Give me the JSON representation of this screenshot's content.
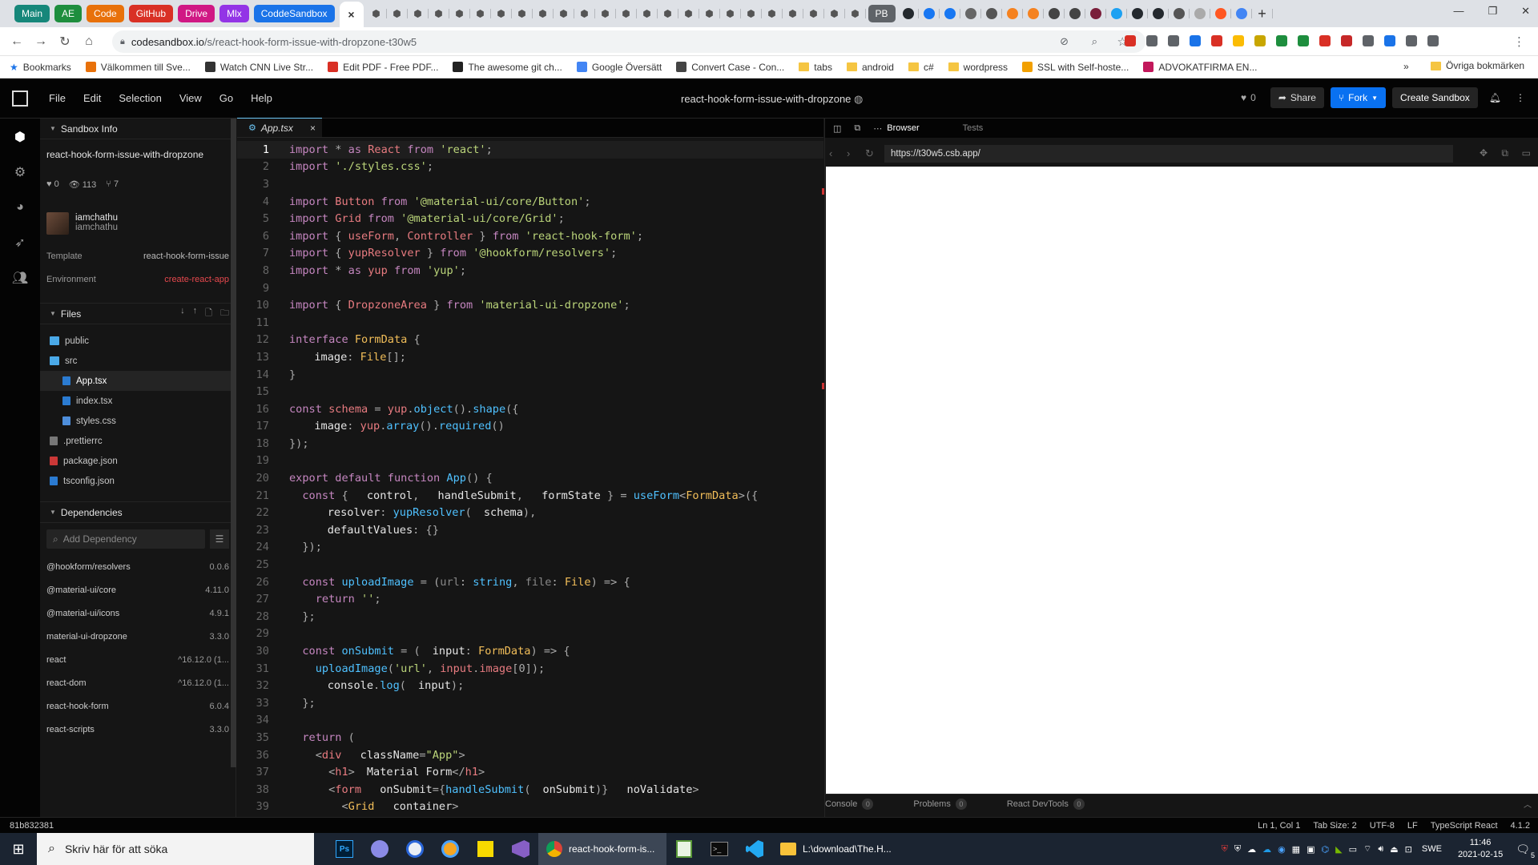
{
  "browser": {
    "group_tabs": [
      {
        "label": "Main",
        "color": "#16877a"
      },
      {
        "label": "AE",
        "color": "#1e8e3e"
      },
      {
        "label": "Code",
        "color": "#e8710a"
      },
      {
        "label": "GitHub",
        "color": "#d93025"
      },
      {
        "label": "Drive",
        "color": "#d01884"
      },
      {
        "label": "Mlx",
        "color": "#9334e6"
      },
      {
        "label": "CoddeSandbox",
        "color": "#1a73e8"
      }
    ],
    "group_tab_last": {
      "label": "PB",
      "color": "#5f6368"
    },
    "active_tab_close": "×",
    "new_tab": "+",
    "url_host": "codesandbox.io",
    "url_path": "/s/react-hook-form-issue-with-dropzone-t30w5",
    "bookmarks": [
      {
        "label": "Bookmarks",
        "kind": "star",
        "color": "#1a73e8"
      },
      {
        "label": "Välkommen till Sve...",
        "kind": "icon",
        "color": "#e8710a"
      },
      {
        "label": "Watch CNN Live Str...",
        "kind": "icon",
        "color": "#333333"
      },
      {
        "label": "Edit PDF - Free PDF...",
        "kind": "icon",
        "color": "#d93025"
      },
      {
        "label": "The awesome git ch...",
        "kind": "icon",
        "color": "#222222"
      },
      {
        "label": "Google Översätt",
        "kind": "icon",
        "color": "#4285f4"
      },
      {
        "label": "Convert Case - Con...",
        "kind": "icon",
        "color": "#444444"
      },
      {
        "label": "tabs",
        "kind": "folder"
      },
      {
        "label": "android",
        "kind": "folder"
      },
      {
        "label": "c#",
        "kind": "folder"
      },
      {
        "label": "wordpress",
        "kind": "folder"
      },
      {
        "label": "SSL with Self-hoste...",
        "kind": "icon",
        "color": "#f2a000"
      },
      {
        "label": "ADVOKATFIRMA EN...",
        "kind": "icon",
        "color": "#c2185b"
      }
    ],
    "bookmarks_more": "»",
    "other_bookmarks": "Övriga bokmärken"
  },
  "cs": {
    "menu": [
      "File",
      "Edit",
      "Selection",
      "View",
      "Go",
      "Help"
    ],
    "title": "react-hook-form-issue-with-dropzone",
    "likes": "0",
    "share": "Share",
    "fork": "Fork",
    "create": "Create Sandbox"
  },
  "sidebar": {
    "info_header": "Sandbox Info",
    "sandbox_name": "react-hook-form-issue-with-dropzone",
    "stats": {
      "likes": "0",
      "views": "113",
      "forks": "7"
    },
    "author_name": "iamchathu",
    "author_user": "iamchathu",
    "template_label": "Template",
    "template_value": "react-hook-form-issue",
    "env_label": "Environment",
    "env_value": "create-react-app",
    "files_header": "Files",
    "files": [
      {
        "name": "public",
        "indent": 0,
        "kind": "folder",
        "color": "#4aa9e8",
        "selected": false
      },
      {
        "name": "src",
        "indent": 0,
        "kind": "folder-open",
        "color": "#4aa9e8",
        "selected": false
      },
      {
        "name": "App.tsx",
        "indent": 1,
        "kind": "file",
        "color": "#2b7bd1",
        "selected": true
      },
      {
        "name": "index.tsx",
        "indent": 1,
        "kind": "file",
        "color": "#2b7bd1",
        "selected": false
      },
      {
        "name": "styles.css",
        "indent": 1,
        "kind": "file",
        "color": "#4e8edb",
        "selected": false
      },
      {
        "name": ".prettierrc",
        "indent": 0,
        "kind": "file",
        "color": "#777777",
        "selected": false
      },
      {
        "name": "package.json",
        "indent": 0,
        "kind": "file",
        "color": "#cb3837",
        "selected": false
      },
      {
        "name": "tsconfig.json",
        "indent": 0,
        "kind": "file",
        "color": "#2b7bd1",
        "selected": false
      }
    ],
    "deps_header": "Dependencies",
    "add_dep_placeholder": "Add Dependency",
    "deps": [
      {
        "name": "@hookform/resolvers",
        "version": "0.0.6"
      },
      {
        "name": "@material-ui/core",
        "version": "4.11.0"
      },
      {
        "name": "@material-ui/icons",
        "version": "4.9.1"
      },
      {
        "name": "material-ui-dropzone",
        "version": "3.3.0"
      },
      {
        "name": "react",
        "version": "^16.12.0 (1..."
      },
      {
        "name": "react-dom",
        "version": "^16.12.0 (1..."
      },
      {
        "name": "react-hook-form",
        "version": "6.0.4"
      },
      {
        "name": "react-scripts",
        "version": "3.3.0"
      }
    ]
  },
  "editor": {
    "tab_name": "App.tsx",
    "tab_close": "×",
    "current_line": 1,
    "lines": [
      [
        [
          "kw",
          "import"
        ],
        [
          "op",
          " * "
        ],
        [
          "kw",
          "as"
        ],
        [
          "id",
          " React "
        ],
        [
          "kw",
          "from"
        ],
        [
          "st",
          " 'react'"
        ],
        [
          "op",
          ";"
        ]
      ],
      [
        [
          "kw",
          "import"
        ],
        [
          "st",
          " './styles.css'"
        ],
        [
          "op",
          ";"
        ]
      ],
      [],
      [
        [
          "kw",
          "import"
        ],
        [
          "id",
          " Button "
        ],
        [
          "kw",
          "from"
        ],
        [
          "st",
          " '@material-ui/core/Button'"
        ],
        [
          "op",
          ";"
        ]
      ],
      [
        [
          "kw",
          "import"
        ],
        [
          "id",
          " Grid "
        ],
        [
          "kw",
          "from"
        ],
        [
          "st",
          " '@material-ui/core/Grid'"
        ],
        [
          "op",
          ";"
        ]
      ],
      [
        [
          "kw",
          "import"
        ],
        [
          "op",
          " { "
        ],
        [
          "id",
          "useForm"
        ],
        [
          "op",
          ", "
        ],
        [
          "id",
          "Controller"
        ],
        [
          "op",
          " } "
        ],
        [
          "kw",
          "from"
        ],
        [
          "st",
          " 'react-hook-form'"
        ],
        [
          "op",
          ";"
        ]
      ],
      [
        [
          "kw",
          "import"
        ],
        [
          "op",
          " { "
        ],
        [
          "id",
          "yupResolver"
        ],
        [
          "op",
          " } "
        ],
        [
          "kw",
          "from"
        ],
        [
          "st",
          " '@hookform/resolvers'"
        ],
        [
          "op",
          ";"
        ]
      ],
      [
        [
          "kw",
          "import"
        ],
        [
          "op",
          " * "
        ],
        [
          "kw",
          "as"
        ],
        [
          "id",
          " yup "
        ],
        [
          "kw",
          "from"
        ],
        [
          "st",
          " 'yup'"
        ],
        [
          "op",
          ";"
        ]
      ],
      [],
      [
        [
          "kw",
          "import"
        ],
        [
          "op",
          " { "
        ],
        [
          "id",
          "DropzoneArea"
        ],
        [
          "op",
          " } "
        ],
        [
          "kw",
          "from"
        ],
        [
          "st",
          " 'material-ui-dropzone'"
        ],
        [
          "op",
          ";"
        ]
      ],
      [],
      [
        [
          "kw",
          "interface"
        ],
        [
          "ty",
          " FormData"
        ],
        [
          "op",
          " {"
        ]
      ],
      [
        [
          "cl",
          "  image"
        ],
        [
          "op",
          ": "
        ],
        [
          "ty",
          "File"
        ],
        [
          "op",
          "[];"
        ]
      ],
      [
        [
          "op",
          "}"
        ]
      ],
      [],
      [
        [
          "kw",
          "const"
        ],
        [
          "id",
          " schema"
        ],
        [
          "op",
          " = "
        ],
        [
          "id",
          "yup"
        ],
        [
          "op",
          "."
        ],
        [
          "fn",
          "object"
        ],
        [
          "op",
          "()."
        ],
        [
          "fn",
          "shape"
        ],
        [
          "op",
          "({"
        ]
      ],
      [
        [
          "cl",
          "  image"
        ],
        [
          "op",
          ": "
        ],
        [
          "id",
          "yup"
        ],
        [
          "op",
          "."
        ],
        [
          "fn",
          "array"
        ],
        [
          "op",
          "()."
        ],
        [
          "fn",
          "required"
        ],
        [
          "op",
          "()"
        ]
      ],
      [
        [
          "op",
          "});"
        ]
      ],
      [],
      [
        [
          "kw",
          "export default function"
        ],
        [
          "fn",
          " App"
        ],
        [
          "op",
          "() {"
        ]
      ],
      [
        [
          "kw",
          "  const"
        ],
        [
          "op",
          " { "
        ],
        [
          "cl",
          "control"
        ],
        [
          "op",
          ", "
        ],
        [
          "cl",
          "handleSubmit"
        ],
        [
          "op",
          ", "
        ],
        [
          "cl",
          "formState"
        ],
        [
          "op",
          " } = "
        ],
        [
          "fn",
          "useForm"
        ],
        [
          "op",
          "<"
        ],
        [
          "ty",
          "FormData"
        ],
        [
          "op",
          ">({"
        ]
      ],
      [
        [
          "cl",
          "    resolver"
        ],
        [
          "op",
          ": "
        ],
        [
          "fn",
          "yupResolver"
        ],
        [
          "op",
          "("
        ],
        [
          "cl",
          "schema"
        ],
        [
          "op",
          "),"
        ]
      ],
      [
        [
          "cl",
          "    defaultValues"
        ],
        [
          "op",
          ": {}"
        ]
      ],
      [
        [
          "op",
          "  });"
        ]
      ],
      [],
      [
        [
          "kw",
          "  const"
        ],
        [
          "fn",
          " uploadImage"
        ],
        [
          "op",
          " = ("
        ],
        [
          "cm",
          "url"
        ],
        [
          "op",
          ": "
        ],
        [
          "fn",
          "string"
        ],
        [
          "op",
          ", "
        ],
        [
          "cm",
          "file"
        ],
        [
          "op",
          ": "
        ],
        [
          "ty",
          "File"
        ],
        [
          "op",
          ") => {"
        ]
      ],
      [
        [
          "kw",
          "    return"
        ],
        [
          "st",
          " ''"
        ],
        [
          "op",
          ";"
        ]
      ],
      [
        [
          "op",
          "  };"
        ]
      ],
      [],
      [
        [
          "kw",
          "  const"
        ],
        [
          "fn",
          " onSubmit"
        ],
        [
          "op",
          " = ("
        ],
        [
          "cl",
          "input"
        ],
        [
          "op",
          ": "
        ],
        [
          "ty",
          "FormData"
        ],
        [
          "op",
          ") => {"
        ]
      ],
      [
        [
          "fn",
          "    uploadImage"
        ],
        [
          "op",
          "("
        ],
        [
          "st",
          "'url'"
        ],
        [
          "op",
          ", "
        ],
        [
          "id",
          "input"
        ],
        [
          "op",
          "."
        ],
        [
          "id",
          "image"
        ],
        [
          "op",
          "[0]);"
        ]
      ],
      [
        [
          "cl",
          "    console"
        ],
        [
          "op",
          "."
        ],
        [
          "fn",
          "log"
        ],
        [
          "op",
          "("
        ],
        [
          "cl",
          "input"
        ],
        [
          "op",
          ");"
        ]
      ],
      [
        [
          "op",
          "  };"
        ]
      ],
      [],
      [
        [
          "kw",
          "  return"
        ],
        [
          "op",
          " ("
        ]
      ],
      [
        [
          "op",
          "    <"
        ],
        [
          "id",
          "div"
        ],
        [
          "cl",
          " className"
        ],
        [
          "op",
          "="
        ],
        [
          "st",
          "\"App\""
        ],
        [
          "op",
          ">"
        ]
      ],
      [
        [
          "op",
          "      <"
        ],
        [
          "id",
          "h1"
        ],
        [
          "op",
          ">"
        ],
        [
          "cl",
          "Material Form"
        ],
        [
          "op",
          "</"
        ],
        [
          "id",
          "h1"
        ],
        [
          "op",
          ">"
        ]
      ],
      [
        [
          "op",
          "      <"
        ],
        [
          "id",
          "form"
        ],
        [
          "cl",
          " onSubmit"
        ],
        [
          "op",
          "={"
        ],
        [
          "fn",
          "handleSubmit"
        ],
        [
          "op",
          "("
        ],
        [
          "cl",
          "onSubmit"
        ],
        [
          "op",
          ")} "
        ],
        [
          "cl",
          "noValidate"
        ],
        [
          "op",
          ">"
        ]
      ],
      [
        [
          "op",
          "        <"
        ],
        [
          "ty",
          "Grid"
        ],
        [
          "cl",
          " container"
        ],
        [
          "op",
          ">"
        ]
      ]
    ]
  },
  "preview": {
    "tab_browser": "Browser",
    "tab_tests": "Tests",
    "url": "https://t30w5.csb.app/",
    "bottom_tabs": [
      {
        "label": "Console",
        "count": "0"
      },
      {
        "label": "Problems",
        "count": "0"
      },
      {
        "label": "React DevTools",
        "count": "0"
      }
    ]
  },
  "status": {
    "hash": "81b832381",
    "position": "Ln 1, Col 1",
    "tab_size": "Tab Size: 2",
    "encoding": "UTF-8",
    "eol": "LF",
    "language": "TypeScript React",
    "version": "4.1.2"
  },
  "taskbar": {
    "search_placeholder": "Skriv här för att söka",
    "chrome_window": "react-hook-form-is...",
    "explorer_window": "L:\\download\\The.H...",
    "lang": "SWE",
    "time": "11:46",
    "date": "2021-02-15",
    "notif_count": "5"
  }
}
